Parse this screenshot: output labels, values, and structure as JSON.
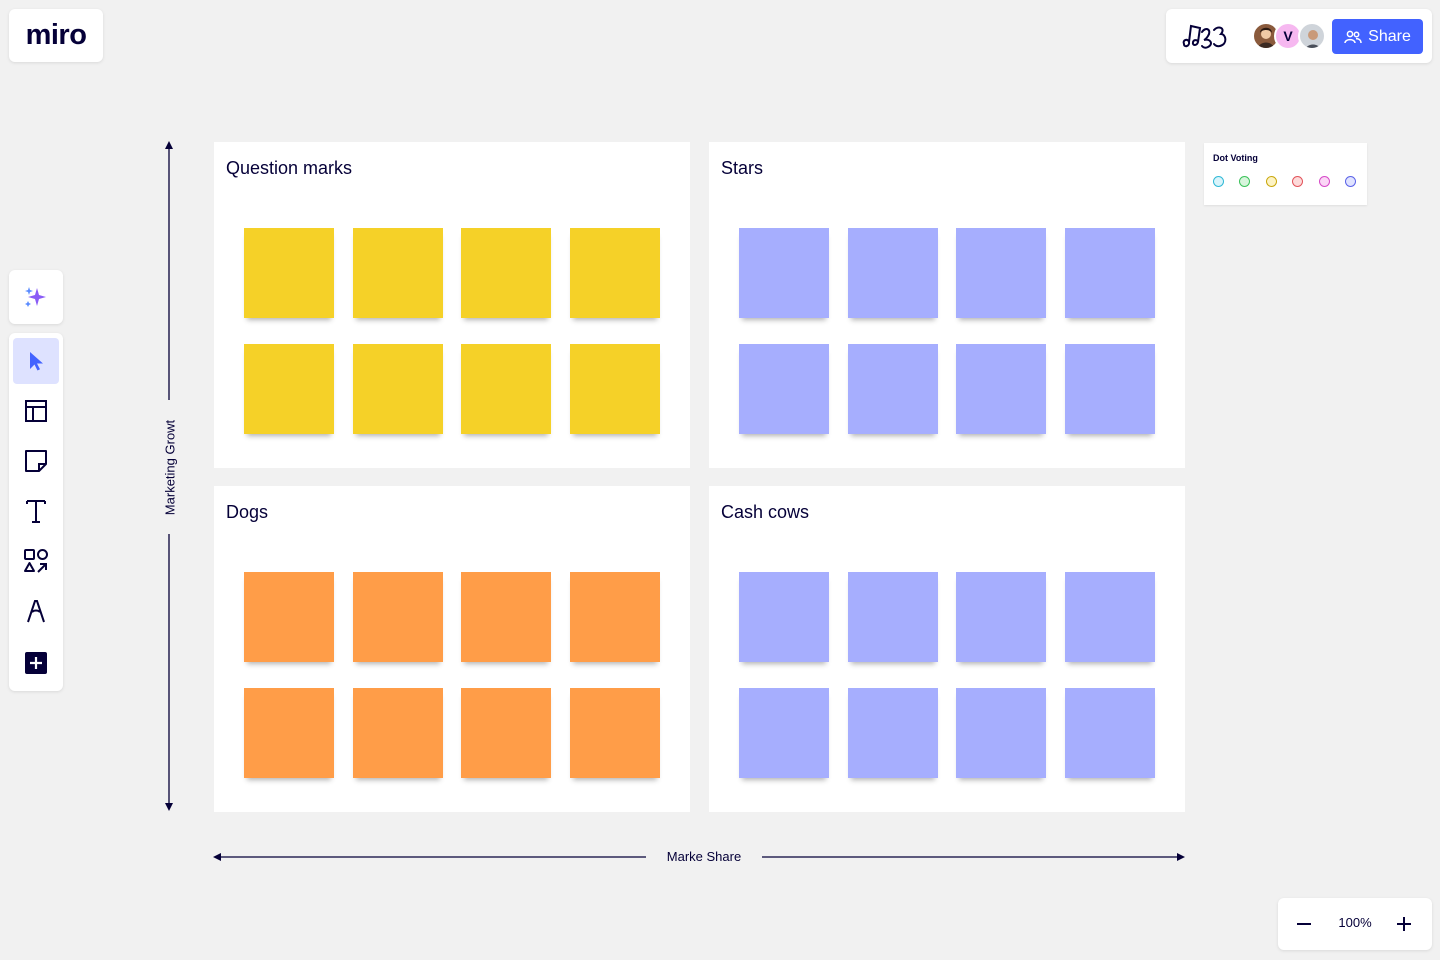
{
  "app": {
    "logo": "miro"
  },
  "topbar": {
    "share_label": "Share",
    "avatars": [
      {
        "name": "user-avatar-1"
      },
      {
        "initial": "V"
      },
      {
        "name": "user-avatar-3"
      }
    ]
  },
  "toolbar": {
    "tools": [
      {
        "name": "select-tool",
        "icon": "cursor-icon",
        "active": true
      },
      {
        "name": "templates-tool",
        "icon": "templates-icon"
      },
      {
        "name": "sticky-note-tool",
        "icon": "sticky-note-icon"
      },
      {
        "name": "text-tool",
        "icon": "text-icon"
      },
      {
        "name": "shapes-tool",
        "icon": "shapes-icon"
      },
      {
        "name": "pen-tool",
        "icon": "pen-icon"
      },
      {
        "name": "more-apps-tool",
        "icon": "plus-square-icon"
      }
    ]
  },
  "board": {
    "quadrants": [
      {
        "key": "question-marks",
        "title": "Question marks",
        "note_color": "#f5d128",
        "notes": 8
      },
      {
        "key": "stars",
        "title": "Stars",
        "note_color": "#a6aefe",
        "notes": 8
      },
      {
        "key": "dogs",
        "title": "Dogs",
        "note_color": "#ff9d48",
        "notes": 8
      },
      {
        "key": "cash-cows",
        "title": "Cash cows",
        "note_color": "#a6aefe",
        "notes": 8
      }
    ],
    "y_axis_label": "Marketing Growt",
    "x_axis_label": "Marke Share"
  },
  "dot_voting": {
    "title": "Dot Voting",
    "dots": [
      {
        "name": "cyan",
        "fill": "#d9f4fb",
        "stroke": "#31b9d6"
      },
      {
        "name": "green",
        "fill": "#d7f5dc",
        "stroke": "#3cc25a"
      },
      {
        "name": "yellow",
        "fill": "#fdf3c4",
        "stroke": "#c9a70c"
      },
      {
        "name": "red",
        "fill": "#fddada",
        "stroke": "#e2545b"
      },
      {
        "name": "pink",
        "fill": "#fbd6f6",
        "stroke": "#d64ac8"
      },
      {
        "name": "violet",
        "fill": "#e0e3ff",
        "stroke": "#5b63e8"
      }
    ]
  },
  "zoom": {
    "level": "100%"
  },
  "colors": {
    "accent": "#4262ff",
    "ink": "#050038",
    "canvas": "#f1f1f1"
  }
}
